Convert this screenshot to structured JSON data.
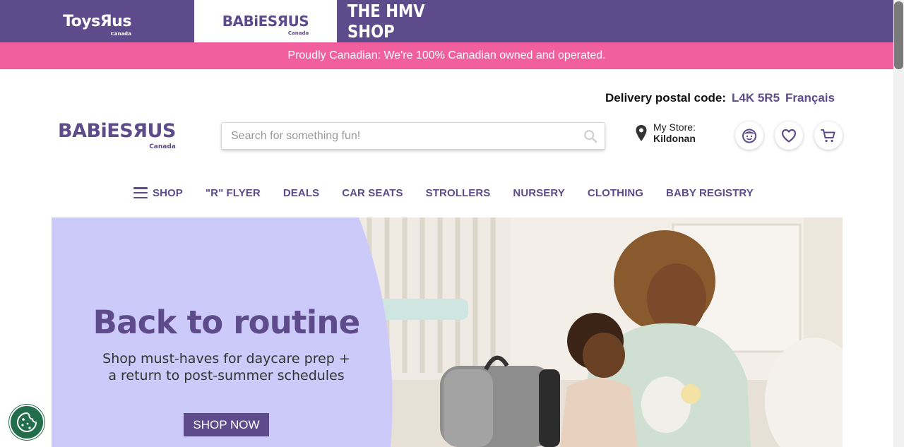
{
  "brands": {
    "toys": {
      "name": "ToysBus",
      "label": "ToysЯus",
      "sub": "Canada"
    },
    "babies": {
      "label": "BABiESЯUS",
      "sub": "Canada"
    },
    "hmv": {
      "label": "THE HMV SHOP"
    }
  },
  "promo": {
    "text": "Proudly Canadian: We're 100% Canadian owned and operated."
  },
  "header": {
    "delivery_label": "Delivery postal code:",
    "postal_code": "L4K 5R5",
    "language": "Français",
    "logo": {
      "label": "BABiESЯUS",
      "sub": "Canada"
    },
    "search_placeholder": "Search for something fun!",
    "store_label": "My Store:",
    "store_name": "Kildonan"
  },
  "nav": {
    "items": [
      {
        "label": "SHOP"
      },
      {
        "label": "\"R\" FLYER"
      },
      {
        "label": "DEALS"
      },
      {
        "label": "CAR SEATS"
      },
      {
        "label": "STROLLERS"
      },
      {
        "label": "NURSERY"
      },
      {
        "label": "CLOTHING"
      },
      {
        "label": "BABY REGISTRY"
      }
    ]
  },
  "hero": {
    "title": "Back to routine",
    "subtitle_line1": "Shop must-haves for daycare prep +",
    "subtitle_line2": "a return to post-summer schedules",
    "cta": "SHOP NOW"
  },
  "colors": {
    "brand_purple": "#5e4b8b",
    "promo_pink": "#f15f9f",
    "hero_lavender": "#cccaf8",
    "cookie_green": "#226e4a"
  },
  "icons": {
    "search": "search-icon",
    "store": "map-pin-icon",
    "account": "account-face-icon",
    "wishlist": "heart-icon",
    "cart": "cart-icon",
    "menu": "hamburger-icon",
    "cookie": "cookie-icon"
  }
}
